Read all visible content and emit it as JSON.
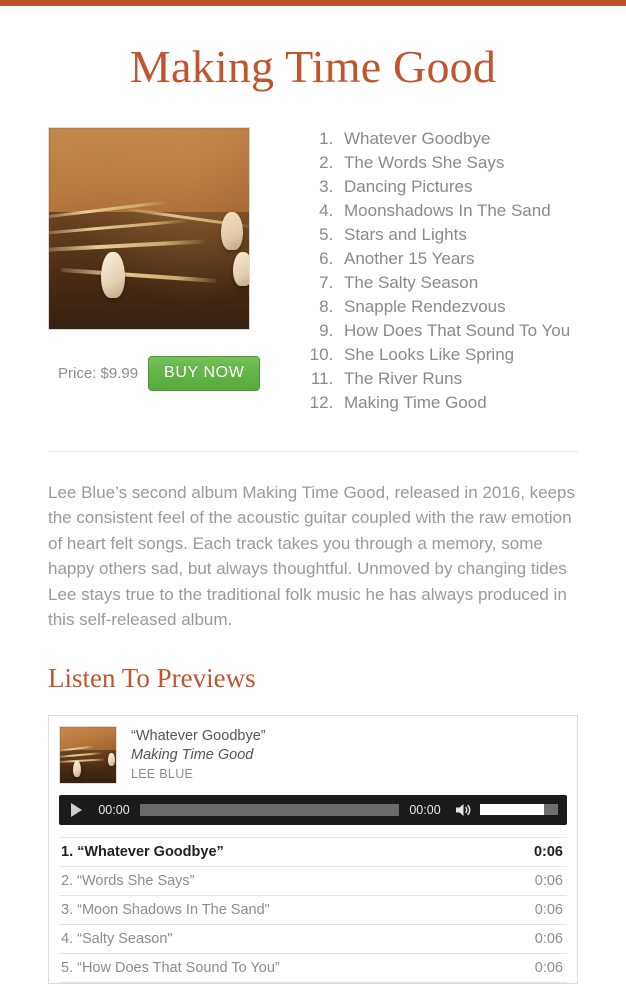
{
  "theme": {
    "accent": "#b8512e",
    "heading_color": "#c0552f",
    "buy_button_green": "#62b348",
    "body_text": "#9a9a9a"
  },
  "header": {
    "album_title": "Making Time Good"
  },
  "album": {
    "art_alt": "album-artwork-guitar-bridge",
    "price_label": "Price: $9.99",
    "buy_button_label": "BUY NOW",
    "tracklist": [
      "Whatever Goodbye",
      "The Words She Says",
      "Dancing Pictures",
      "Moonshadows In The Sand",
      "Stars and Lights",
      "Another 15 Years",
      "The Salty Season",
      "Snapple Rendezvous",
      "How Does That Sound To You",
      "She Looks Like Spring",
      "The River Runs",
      "Making Time Good"
    ]
  },
  "description": {
    "text": "Lee Blue’s second album Making Time Good, released in 2016, keeps the consistent feel of the acoustic guitar coupled with the raw emotion of heart felt songs. Each track takes you through a memory, some happy others sad, but always thoughtful. Unmoved by changing tides Lee stays true to the traditional folk music he has always produced in this self-released album."
  },
  "previews": {
    "heading": "Listen To Previews",
    "now_playing": {
      "track_title": "“Whatever Goodbye”",
      "album": "Making Time Good",
      "artist": "LEE BLUE"
    },
    "player": {
      "play_icon": "play-icon",
      "current_time": "00:00",
      "duration": "00:00",
      "volume_icon": "speaker-icon",
      "progress_percent": 0,
      "volume_percent": 85
    },
    "tracks": [
      {
        "index": "1.",
        "title": "“Whatever Goodbye”",
        "duration": "0:06",
        "active": true
      },
      {
        "index": "2.",
        "title": "“Words She Says”",
        "duration": "0:06",
        "active": false
      },
      {
        "index": "3.",
        "title": "“Moon Shadows In The Sand\"",
        "duration": "0:06",
        "active": false
      },
      {
        "index": "4.",
        "title": "“Salty Season\"",
        "duration": "0:06",
        "active": false
      },
      {
        "index": "5.",
        "title": "“How Does That Sound To You”",
        "duration": "0:06",
        "active": false
      }
    ]
  }
}
